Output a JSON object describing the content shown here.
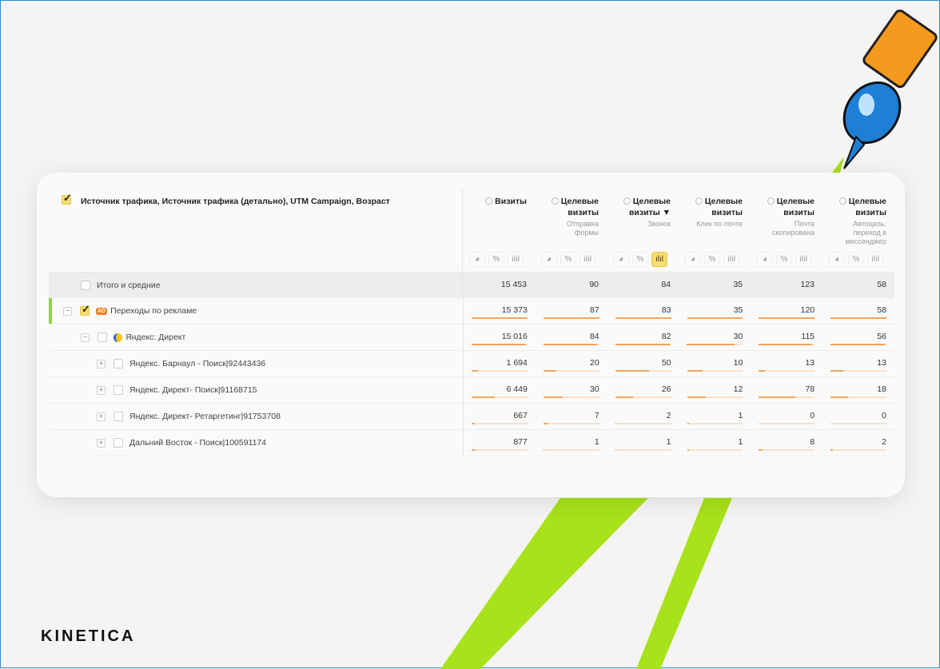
{
  "brand": "KINETICA",
  "colors": {
    "accent": "#f7dc6f",
    "bar": "#f5a55a",
    "stripe": "#a8e21a"
  },
  "header": {
    "dimensions": "Источник трафика, Источник трафика (детально), UTM Campaign, Возраст",
    "metrics": [
      {
        "title": "Визиты",
        "sub": ""
      },
      {
        "title": "Целевые визиты",
        "sub": "Отправка формы"
      },
      {
        "title": "Целевые визиты",
        "sub": "Звонок",
        "sorted": "▼"
      },
      {
        "title": "Целевые визиты",
        "sub": "Клик по почте"
      },
      {
        "title": "Целевые визиты",
        "sub": "Почта скопирована"
      },
      {
        "title": "Целевые визиты",
        "sub": "Автоцель: переход в мессенджер"
      }
    ],
    "controls": {
      "pie": "◕",
      "percent": "%",
      "bars": "ılıl"
    }
  },
  "total": {
    "label": "Итого и средние",
    "values": [
      "15 453",
      "90",
      "84",
      "35",
      "123",
      "58"
    ]
  },
  "rows": [
    {
      "label": "Переходы по рекламе",
      "badge": "AD",
      "level": 0,
      "toggle": "−",
      "checked": true,
      "values": [
        "15 373",
        "87",
        "83",
        "35",
        "120",
        "58"
      ],
      "nums": [
        15373,
        87,
        83,
        35,
        120,
        58
      ]
    },
    {
      "label": "Яндекс: Директ",
      "level": 1,
      "toggle": "−",
      "checked": false,
      "values": [
        "15 016",
        "84",
        "82",
        "30",
        "115",
        "56"
      ],
      "nums": [
        15016,
        84,
        82,
        30,
        115,
        56
      ]
    },
    {
      "label": "Яндекс. Барнаул - Поиск|92443436",
      "level": 2,
      "toggle": "+",
      "checked": false,
      "values": [
        "1 694",
        "20",
        "50",
        "10",
        "13",
        "13"
      ],
      "nums": [
        1694,
        20,
        50,
        10,
        13,
        13
      ]
    },
    {
      "label": "Яндекс. Директ- Поиск|91168715",
      "level": 2,
      "toggle": "+",
      "checked": false,
      "values": [
        "6 449",
        "30",
        "26",
        "12",
        "78",
        "18"
      ],
      "nums": [
        6449,
        30,
        26,
        12,
        78,
        18
      ]
    },
    {
      "label": "Яндекс. Директ- Ретаргетинг|91753708",
      "level": 2,
      "toggle": "+",
      "checked": false,
      "values": [
        "667",
        "7",
        "2",
        "1",
        "0",
        "0"
      ],
      "nums": [
        667,
        7,
        2,
        1,
        0,
        0
      ]
    },
    {
      "label": "Дальний Восток - Поиск|100591174",
      "level": 2,
      "toggle": "+",
      "checked": false,
      "values": [
        "877",
        "1",
        "1",
        "1",
        "8",
        "2"
      ],
      "nums": [
        877,
        1,
        1,
        1,
        8,
        2
      ]
    }
  ]
}
